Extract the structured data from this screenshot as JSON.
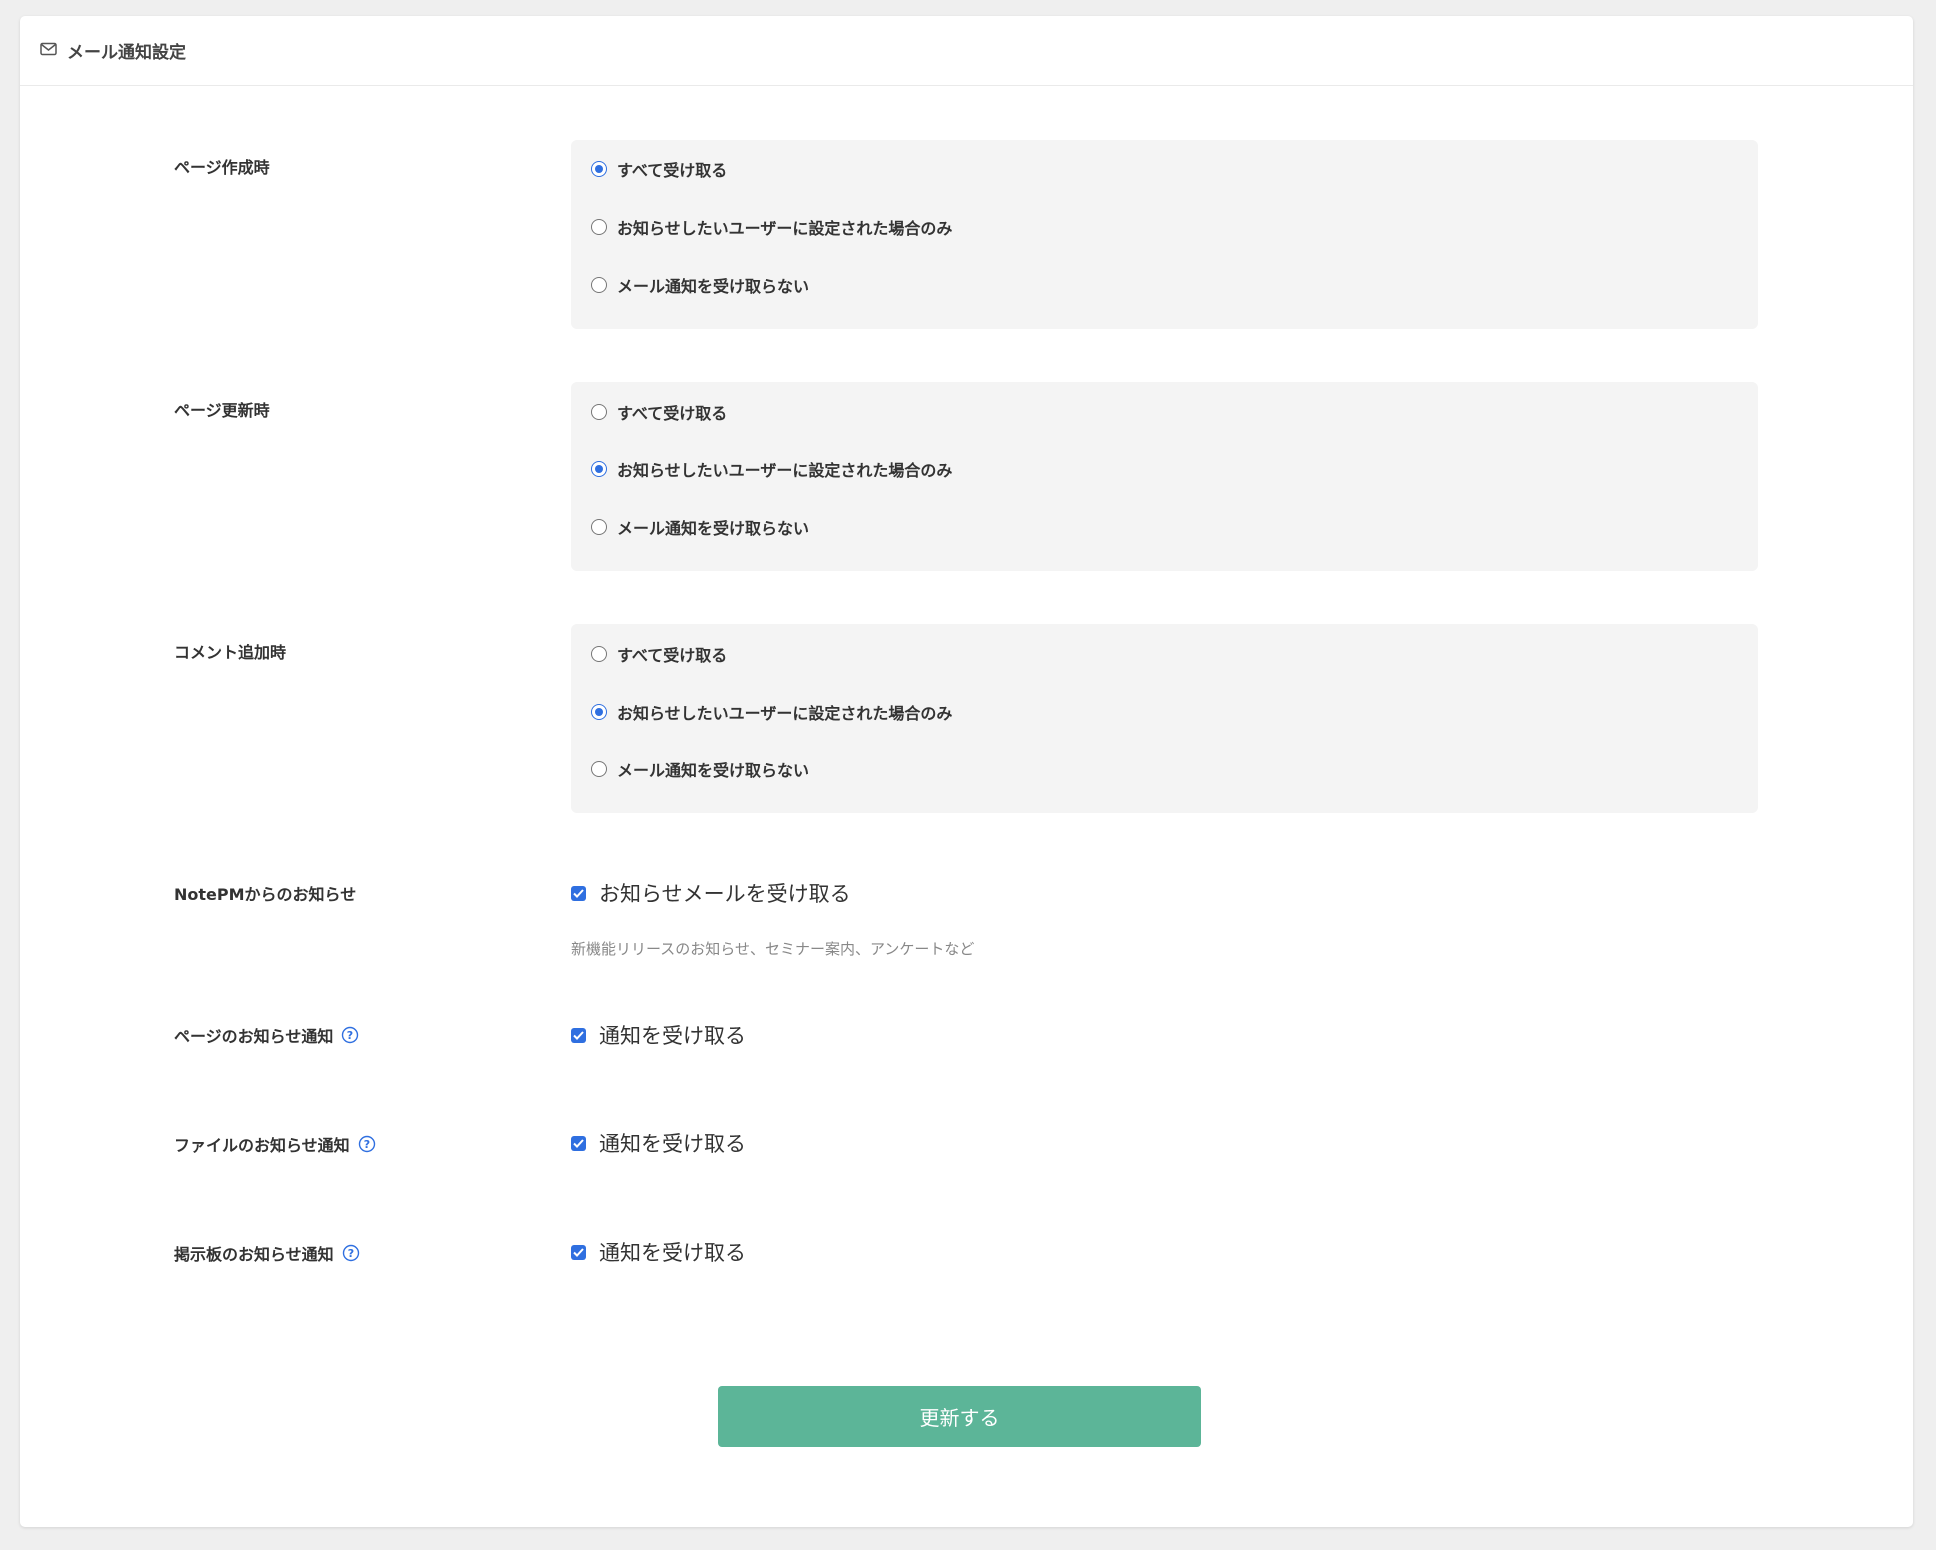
{
  "header": {
    "title": "メール通知設定",
    "icon": "envelope-icon"
  },
  "radio_groups": [
    {
      "label": "ページ作成時",
      "options": [
        {
          "label": "すべて受け取る",
          "checked": true
        },
        {
          "label": "お知らせしたいユーザーに設定された場合のみ",
          "checked": false
        },
        {
          "label": "メール通知を受け取らない",
          "checked": false
        }
      ]
    },
    {
      "label": "ページ更新時",
      "options": [
        {
          "label": "すべて受け取る",
          "checked": false
        },
        {
          "label": "お知らせしたいユーザーに設定された場合のみ",
          "checked": true
        },
        {
          "label": "メール通知を受け取らない",
          "checked": false
        }
      ]
    },
    {
      "label": "コメント追加時",
      "options": [
        {
          "label": "すべて受け取る",
          "checked": false
        },
        {
          "label": "お知らせしたいユーザーに設定された場合のみ",
          "checked": true
        },
        {
          "label": "メール通知を受け取らない",
          "checked": false
        }
      ]
    }
  ],
  "notepm_news": {
    "label": "NotePMからのお知らせ",
    "checkbox_label": "お知らせメールを受け取る",
    "checked": true,
    "hint": "新機能リリースのお知らせ、セミナー案内、アンケートなど"
  },
  "page_notice": {
    "label": "ページのお知らせ通知",
    "checkbox_label": "通知を受け取る",
    "checked": true
  },
  "file_notice": {
    "label": "ファイルのお知らせ通知",
    "checkbox_label": "通知を受け取る",
    "checked": true
  },
  "board_notice": {
    "label": "掲示板のお知らせ通知",
    "checkbox_label": "通知を受け取る",
    "checked": true
  },
  "submit": {
    "label": "更新する"
  },
  "colors": {
    "accent": "#2f6fe0",
    "submit": "#5cb598",
    "panel": "#f4f4f4"
  }
}
